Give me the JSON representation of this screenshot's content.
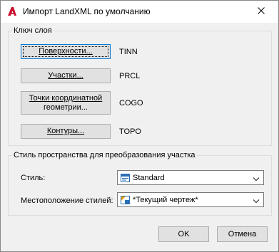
{
  "window": {
    "title": "Импорт LandXML по умолчанию"
  },
  "layer_group": {
    "title": "Ключ слоя",
    "rows": [
      {
        "button_label": "Поверхности...",
        "code": "TINN"
      },
      {
        "button_label": "Участки...",
        "code": "PRCL"
      },
      {
        "button_label_line1": "Точки координатной",
        "button_label_line2": "геометрии...",
        "code": "COGO"
      },
      {
        "button_label": "Контуры...",
        "code": "TOPO"
      }
    ]
  },
  "style_group": {
    "title": "Стиль пространства для преобразования участка",
    "style_label": "Стиль:",
    "style_value": "Standard",
    "location_label": "Местоположение стилей:",
    "location_value": "*Текущий чертеж*"
  },
  "footer": {
    "ok_label": "OK",
    "cancel_label": "Отмена"
  },
  "icons": {
    "app": "autocad-logo-icon",
    "close": "close-icon",
    "style": "style-icon",
    "location": "drawing-icon",
    "dropdown": "chevron-down-icon"
  },
  "colors": {
    "accent": "#0078d7",
    "app_icon_red": "#c8102e"
  }
}
